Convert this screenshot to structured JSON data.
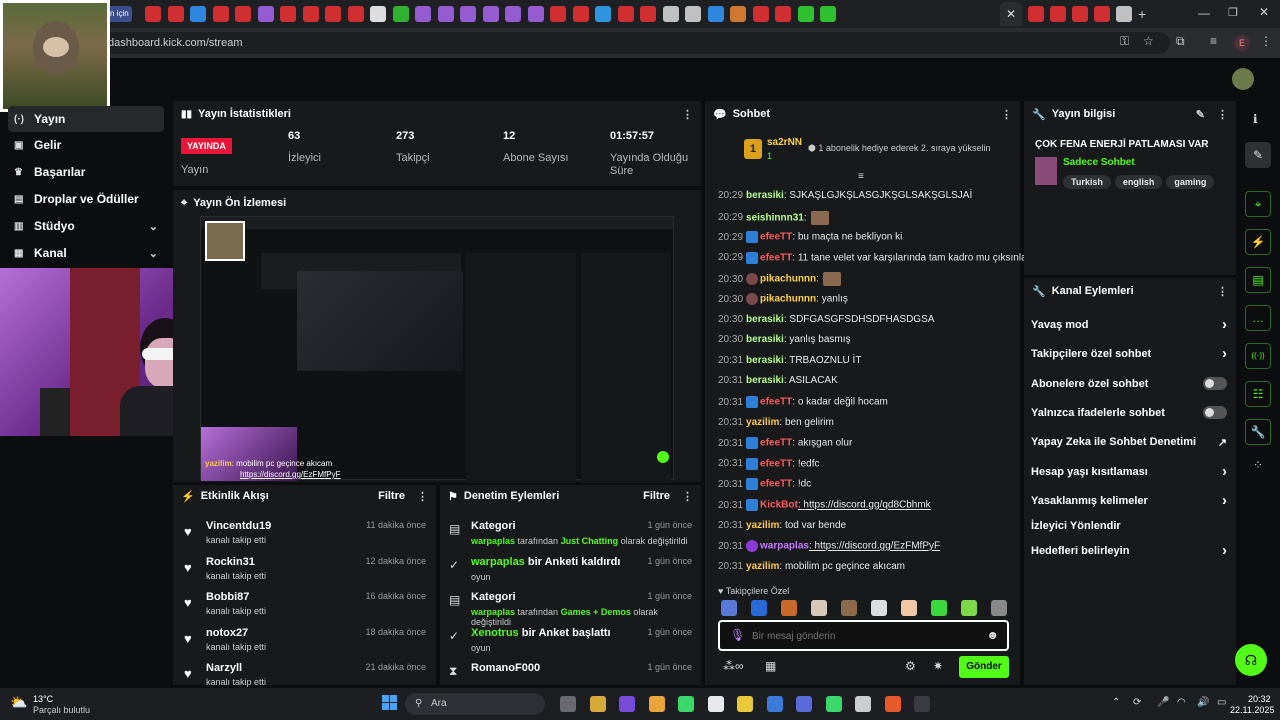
{
  "browser": {
    "url": "dashboard.kick.com/stream",
    "tab_badge": "n için",
    "profile_initial": "E"
  },
  "sidebar": {
    "items": [
      {
        "label": "Yayın",
        "icon": "broadcast-icon"
      },
      {
        "label": "Gelir",
        "icon": "money-icon"
      },
      {
        "label": "Başarılar",
        "icon": "trophy-icon"
      },
      {
        "label": "Droplar ve Ödüller",
        "icon": "gift-icon"
      },
      {
        "label": "Stüdyo",
        "icon": "studio-icon"
      },
      {
        "label": "Kanal",
        "icon": "channel-icon"
      }
    ]
  },
  "stats": {
    "title": "Yayın İstatistikleri",
    "live_badge": "YAYINDA",
    "live_label": "Yayın",
    "viewers_value": "63",
    "viewers_label": "İzleyici",
    "followers_value": "273",
    "followers_label": "Takipçi",
    "subs_value": "12",
    "subs_label": "Abone Sayısı",
    "uptime_value": "01:57:57",
    "uptime_label": "Yayında Olduğu Süre"
  },
  "preview": {
    "title": "Yayın Ön İzlemesi",
    "chat_user": "yazilim",
    "chat_text": ": mobilim pc geçince akıcam",
    "chat_link": "https://discord.gg/EzFMfPyF"
  },
  "activity": {
    "title": "Etkinlik Akışı",
    "filter": "Filtre",
    "items": [
      {
        "name": "Vincentdu19",
        "sub": "kanalı takip etti",
        "time": "11 dakika önce"
      },
      {
        "name": "Rockin31",
        "sub": "kanalı takip etti",
        "time": "12 dakika önce"
      },
      {
        "name": "Bobbi87",
        "sub": "kanalı takip etti",
        "time": "16 dakika önce"
      },
      {
        "name": "notox27",
        "sub": "kanalı takip etti",
        "time": "18 dakika önce"
      },
      {
        "name": "Narzyll",
        "sub": "kanalı takip etti",
        "time": "21 dakika önce"
      }
    ]
  },
  "moderation": {
    "title": "Denetim Eylemleri",
    "filter": "Filtre",
    "items": [
      {
        "name": "Kategori",
        "sub_user": "warpaplas",
        "sub_mid": " tarafından ",
        "sub_hl": "Just Chatting",
        "sub_end": " olarak değiştirildi",
        "time": "1 gün önce"
      },
      {
        "name_hl": "warpaplas",
        "name_rest": " bir Anketi kaldırdı",
        "sub": "oyun",
        "time": "1 gün önce"
      },
      {
        "name": "Kategori",
        "sub_user": "warpaplas",
        "sub_mid": " tarafından ",
        "sub_hl": "Games + Demos",
        "sub_end": " olarak değiştirildi",
        "time": "1 gün önce"
      },
      {
        "name_hl": "Xenotrus",
        "name_rest": " bir Anket başlattı",
        "sub": "oyun",
        "time": "1 gün önce"
      },
      {
        "name": "RomanoF000",
        "time": "1 gün önce"
      }
    ]
  },
  "chat": {
    "title": "Sohbet",
    "top_user": "sa2rNN",
    "top_rank": "1",
    "top_count": "1",
    "gift_text": "1 abonelik hediye ederek 2. sıraya yükselin",
    "messages": [
      {
        "time": "20:29",
        "user": "berasiki",
        "color": "#b6ff8a",
        "text": ": SJKAŞLGJKŞLASGJKŞGLSAKŞGLSJAİ"
      },
      {
        "time": "20:29",
        "user": "seishinnn31",
        "color": "#b6ff8a",
        "text": ":"
      },
      {
        "time": "20:29",
        "user": "efeeTT",
        "color": "#ff5a5a",
        "text": ": bu maçta ne bekliyon ki"
      },
      {
        "time": "20:29",
        "user": "efeeTT",
        "color": "#ff5a5a",
        "text": ": 11 tane velet var karşılarında tam kadro mu çıksınlar"
      },
      {
        "time": "20:30",
        "user": "pikachunnn",
        "color": "#ffd24a",
        "text": ":"
      },
      {
        "time": "20:30",
        "user": "pikachunnn",
        "color": "#ffd24a",
        "text": ": yanlış"
      },
      {
        "time": "20:30",
        "user": "berasiki",
        "color": "#b6ff8a",
        "text": ": SDFGASGFSDHSDFHASDGSA"
      },
      {
        "time": "20:30",
        "user": "berasiki",
        "color": "#b6ff8a",
        "text": ": yanlış basmış"
      },
      {
        "time": "20:31",
        "user": "berasiki",
        "color": "#b6ff8a",
        "text": ": TRBAOZNLU İT"
      },
      {
        "time": "20:31",
        "user": "berasiki",
        "color": "#b6ff8a",
        "text": ": ASILACAK"
      },
      {
        "time": "20:31",
        "user": "efeeTT",
        "color": "#ff5a5a",
        "text": ": o kadar değil hocam"
      },
      {
        "time": "20:31",
        "user": "yazilim",
        "color": "#ffc94a",
        "text": ": ben gelirim"
      },
      {
        "time": "20:31",
        "user": "efeeTT",
        "color": "#ff5a5a",
        "text": ": akışgan olur"
      },
      {
        "time": "20:31",
        "user": "efeeTT",
        "color": "#ff5a5a",
        "text": ": !edfc"
      },
      {
        "time": "20:31",
        "user": "efeeTT",
        "color": "#ff5a5a",
        "text": ": !dc"
      },
      {
        "time": "20:31",
        "user": "KickBot",
        "color": "#ff5a5a",
        "text": ": https://discord.gg/qd8Cbhmk"
      },
      {
        "time": "20:31",
        "user": "yazilim",
        "color": "#ffc94a",
        "text": ": tod var bende"
      },
      {
        "time": "20:31",
        "user": "warpaplas",
        "color": "#c77dff",
        "text": ": https://discord.gg/EzFMfPyF"
      },
      {
        "time": "20:31",
        "user": "yazilim",
        "color": "#ffc94a",
        "text": ": mobilim pc geçince akıcam"
      }
    ],
    "emote_section": "Takipçilere Özel",
    "input_placeholder": "Bir mesaj gönderin",
    "send_label": "Gönder"
  },
  "stream_info": {
    "title": "Yayın bilgisi",
    "stream_title": "ÇOK FENA ENERJİ PATLAMASI VAR",
    "category": "Sadece Sohbet",
    "tags": [
      "Turkish",
      "english",
      "gaming"
    ]
  },
  "channel_actions": {
    "title": "Kanal Eylemleri",
    "items": [
      {
        "label": "Yavaş mod",
        "type": "chevron"
      },
      {
        "label": "Takipçilere özel sohbet",
        "type": "chevron"
      },
      {
        "label": "Abonelere özel sohbet",
        "type": "toggle"
      },
      {
        "label": "Yalnızca ifadelerle sohbet",
        "type": "toggle"
      },
      {
        "label": "Yapay Zeka ile Sohbet Denetimi",
        "type": "external"
      },
      {
        "label": "Hesap yaşı kısıtlaması",
        "type": "chevron"
      },
      {
        "label": "Yasaklanmış kelimeler",
        "type": "chevron"
      },
      {
        "label": "İzleyici Yönlendir",
        "type": "none"
      },
      {
        "label": "Hedefleri belirleyin",
        "type": "chevron"
      }
    ]
  },
  "taskbar": {
    "weather_temp": "13°C",
    "weather_text": "Parçalı bulutlu",
    "search_placeholder": "Ara",
    "time": "20:32",
    "date": "22.11.2025"
  },
  "colors": {
    "accent": "#53fc18",
    "live": "#e8173a"
  }
}
